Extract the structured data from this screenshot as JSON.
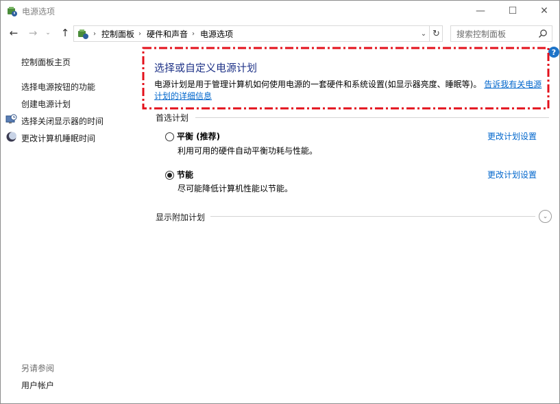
{
  "window": {
    "title": "电源选项",
    "min": "—",
    "max": "☐",
    "close": "✕"
  },
  "nav": {
    "back": "←",
    "forward": "→",
    "recent": "⌄",
    "up": "↑",
    "breadcrumbs": [
      "控制面板",
      "硬件和声音",
      "电源选项"
    ],
    "separator": "›",
    "dropdown": "⌄",
    "refresh": "↻",
    "search_placeholder": "搜索控制面板"
  },
  "sidebar": {
    "home": "控制面板主页",
    "items": [
      {
        "label": "选择电源按钮的功能",
        "icon": "none"
      },
      {
        "label": "创建电源计划",
        "icon": "none"
      },
      {
        "label": "选择关闭显示器的时间",
        "icon": "monitor-clock-icon"
      },
      {
        "label": "更改计算机睡眠时间",
        "icon": "moon-icon"
      }
    ],
    "see_also_title": "另请参阅",
    "see_also_items": [
      "用户帐户"
    ]
  },
  "main": {
    "help": "?",
    "title": "选择或自定义电源计划",
    "description": "电源计划是用于管理计算机如何使用电源的一套硬件和系统设置(如显示器亮度、睡眠等)。",
    "description_link": "告诉我有关电源计划的详细信息",
    "preferred_label": "首选计划",
    "plans": [
      {
        "name": "平衡 (推荐)",
        "desc": "利用可用的硬件自动平衡功耗与性能。",
        "link": "更改计划设置",
        "selected": false
      },
      {
        "name": "节能",
        "desc": "尽可能降低计算机性能以节能。",
        "link": "更改计划设置",
        "selected": true
      }
    ],
    "additional_label": "显示附加计划",
    "expand": "⌄"
  },
  "colors": {
    "highlight_border": "#e3101b",
    "link": "#0066cc",
    "title": "#1e3287"
  }
}
